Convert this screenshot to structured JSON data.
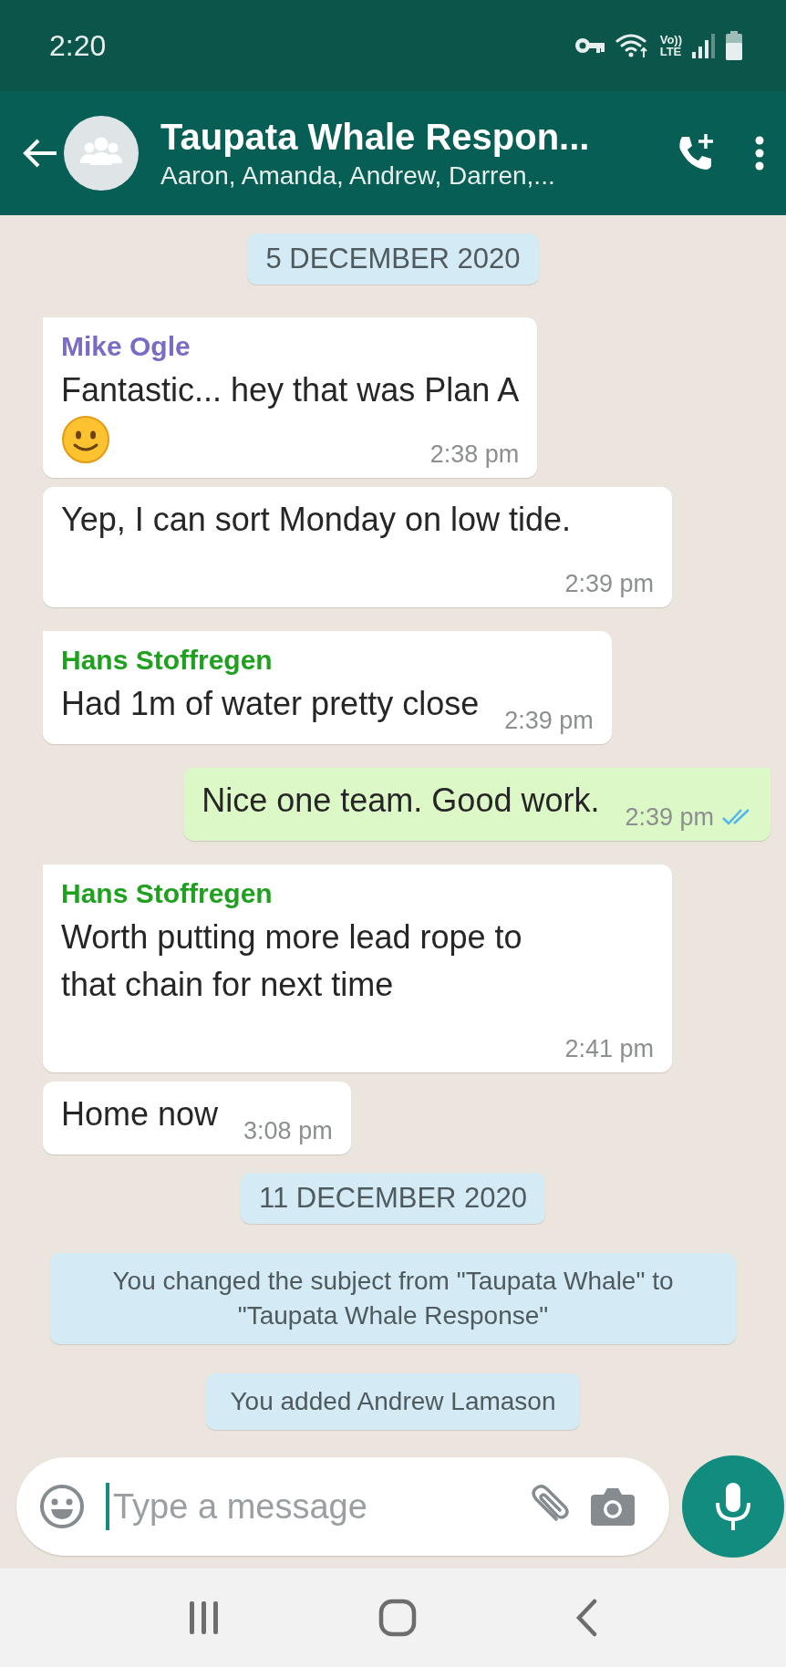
{
  "status_bar": {
    "time": "2:20",
    "volte_top": "Vo))",
    "volte_bottom": "LTE"
  },
  "header": {
    "title": "Taupata Whale Respon...",
    "subtitle": "Aaron, Amanda, Andrew, Darren,..."
  },
  "messages": [
    {
      "kind": "date",
      "text": "5 DECEMBER 2020"
    },
    {
      "kind": "incoming",
      "tail": true,
      "sender": "Mike Ogle",
      "color": "#7b6bc4",
      "text": "Fantastic... hey  that was Plan A",
      "emoji": true,
      "time": "2:38 pm"
    },
    {
      "kind": "incoming",
      "tail": false,
      "text": "Yep, I can sort Monday on low tide.",
      "emoji": false,
      "time": "2:39 pm"
    },
    {
      "kind": "incoming",
      "tail": true,
      "sender": "Hans Stoffregen",
      "color": "#1fa01f",
      "text": "Had 1m of water pretty close",
      "emoji": false,
      "time": "2:39 pm"
    },
    {
      "kind": "outgoing",
      "tail": true,
      "text": "Nice one team. Good work.",
      "time": "2:39 pm",
      "read": true
    },
    {
      "kind": "incoming",
      "tail": true,
      "sender": "Hans Stoffregen",
      "color": "#1fa01f",
      "text": "Worth putting more lead rope to that chain for next time",
      "emoji": false,
      "time": "2:41 pm"
    },
    {
      "kind": "incoming",
      "tail": false,
      "text": "Home now",
      "emoji": false,
      "time": "3:08 pm"
    },
    {
      "kind": "date",
      "text": "11 DECEMBER 2020"
    },
    {
      "kind": "system",
      "text": "You changed the subject from \"Taupata Whale\" to \"Taupata Whale Response\""
    },
    {
      "kind": "system",
      "text": "You added Andrew Lamason"
    }
  ],
  "composer": {
    "placeholder": "Type a message"
  }
}
